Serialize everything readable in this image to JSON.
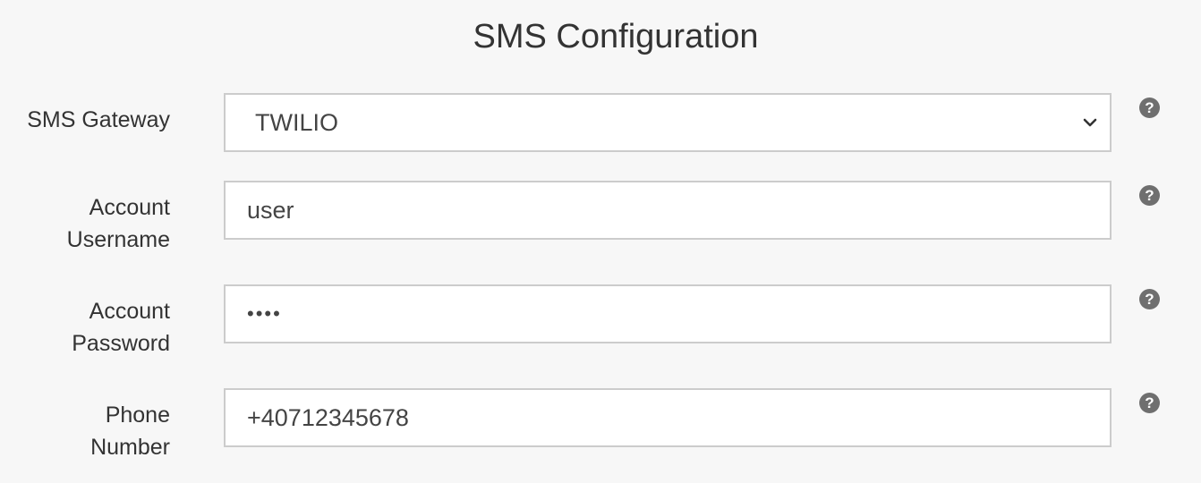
{
  "page": {
    "title": "SMS Configuration"
  },
  "form": {
    "gateway": {
      "label": "SMS Gateway",
      "selected": "TWILIO",
      "help_icon": "question-circle-icon"
    },
    "username": {
      "label_line1": "Account",
      "label_line2": "Username",
      "value": "user",
      "help_icon": "question-circle-icon"
    },
    "password": {
      "label_line1": "Account",
      "label_line2": "Password",
      "value": "••••",
      "help_icon": "question-circle-icon"
    },
    "phone": {
      "label_line1": "Phone",
      "label_line2": "Number",
      "value": "+40712345678",
      "help_icon": "question-circle-icon"
    }
  },
  "help_glyph": "?",
  "colors": {
    "background": "#f7f7f7",
    "field_border": "#cccccc",
    "help_icon": "#6f6f6f"
  }
}
